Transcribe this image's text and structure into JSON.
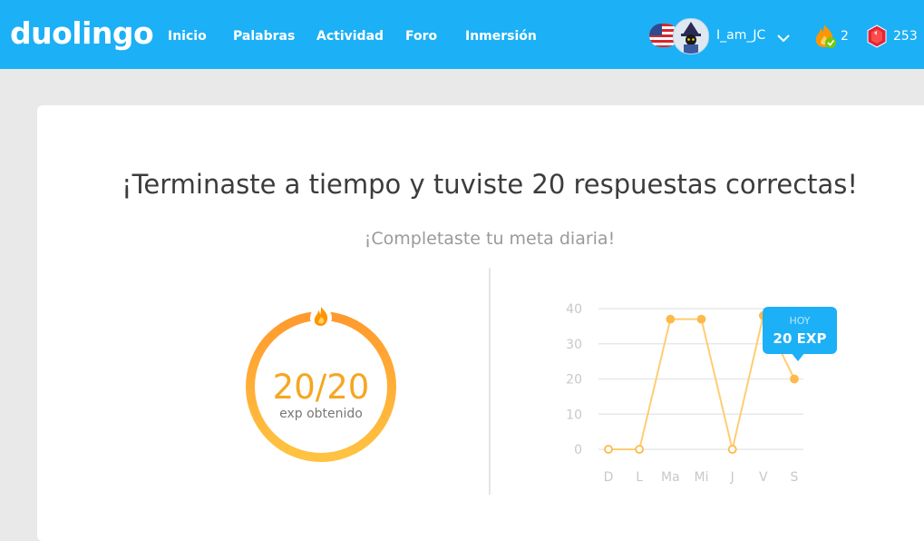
{
  "header": {
    "logo": "duolingo",
    "nav": [
      "Inicio",
      "Palabras",
      "Actividad",
      "Foro",
      "Inmersión"
    ],
    "username": "I_am_JC",
    "streak": "2",
    "gems": "253",
    "colors": {
      "bar": "#1cb0f6",
      "streak": "#ff9600",
      "gem": "#e0263a"
    }
  },
  "main": {
    "headline": "¡Terminaste a tiempo y tuviste 20 respuestas correctas!",
    "subline": "¡Completaste tu meta diaria!",
    "ring": {
      "value": "20/20",
      "label": "exp obtenido",
      "fraction": 1.0
    }
  },
  "chart_data": {
    "type": "line",
    "categories": [
      "D",
      "L",
      "Ma",
      "Mi",
      "J",
      "V",
      "S"
    ],
    "values": [
      0,
      0,
      37,
      37,
      0,
      38,
      20
    ],
    "ylim": [
      0,
      40
    ],
    "yticks": [
      0,
      10,
      20,
      30,
      40
    ],
    "grid": true,
    "line_color": "#ffcd72",
    "highlight": {
      "label": "HOY",
      "value": "20 EXP",
      "index": 6
    }
  }
}
